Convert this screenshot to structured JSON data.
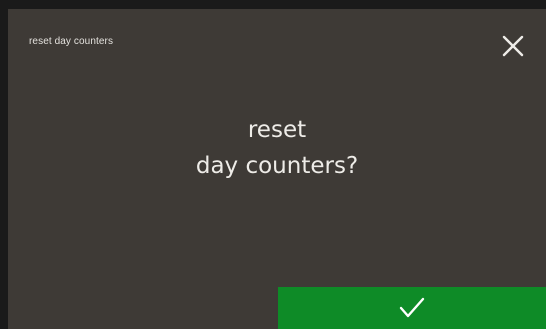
{
  "header": {
    "title": "reset day counters",
    "close_icon": "close-icon"
  },
  "dialog": {
    "message_line1": "reset",
    "message_line2": "day counters?"
  },
  "actions": {
    "confirm_icon": "checkmark-icon"
  },
  "colors": {
    "background": "#3e3a36",
    "confirm": "#0e8b27",
    "text": "#eeece8"
  }
}
